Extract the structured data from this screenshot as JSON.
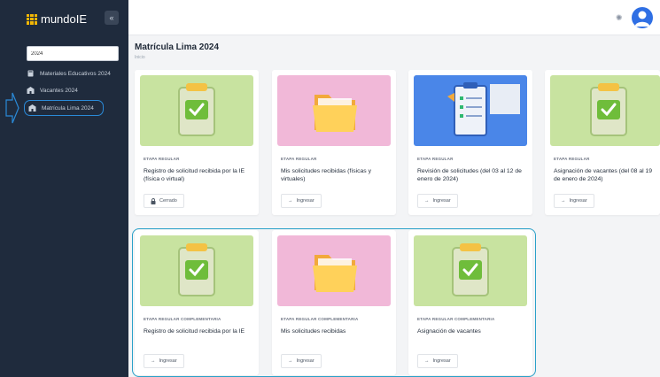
{
  "app": {
    "name": "mundoIE"
  },
  "sidebar": {
    "search_value": "2024",
    "items": [
      {
        "label": "Materiales Educativos 2024"
      },
      {
        "label": "Vacantes 2024"
      },
      {
        "label": "Matrícula Lima 2024"
      }
    ]
  },
  "page": {
    "title": "Matrícula Lima 2024",
    "breadcrumb": "Inicio"
  },
  "cards": [
    {
      "stage": "ETAPA REGULAR",
      "desc": "Registro de solicitud recibida por la IE (física o virtual)",
      "button": "Cerrado",
      "icon": "lock-icon",
      "image": "clipboard-check"
    },
    {
      "stage": "ETAPA REGULAR",
      "desc": "Mis solicitudes recibidas (físicas y virtuales)",
      "button": "Ingresar",
      "icon": "arrow-right-icon",
      "image": "folder"
    },
    {
      "stage": "ETAPA REGULAR",
      "desc": "Revisión de solicitudes (del 03 al 12 de enero de 2024)",
      "button": "Ingresar",
      "icon": "arrow-right-icon",
      "image": "review-list"
    },
    {
      "stage": "ETAPA REGULAR",
      "desc": "Asignación de vacantes (del 08 al 19 de enero de 2024)",
      "button": "Ingresar",
      "icon": "arrow-right-icon",
      "image": "clipboard-check"
    },
    {
      "stage": "ETAPA REGULAR COMPLEMENTARIA",
      "desc": "Registro de solicitud recibida por la IE",
      "button": "Ingresar",
      "icon": "arrow-right-icon",
      "image": "clipboard-check"
    },
    {
      "stage": "ETAPA REGULAR COMPLEMENTARIA",
      "desc": "Mis solicitudes recibidas",
      "button": "Ingresar",
      "icon": "arrow-right-icon",
      "image": "folder"
    },
    {
      "stage": "ETAPA REGULAR COMPLEMENTARIA",
      "desc": "Asignación de vacantes",
      "button": "Ingresar",
      "icon": "arrow-right-icon",
      "image": "clipboard-check"
    }
  ],
  "colors": {
    "sidebar": "#1f2b3d",
    "accent": "#2a8ad8",
    "highlight": "#2aa1c9",
    "brand_yellow": "#f2b705"
  }
}
